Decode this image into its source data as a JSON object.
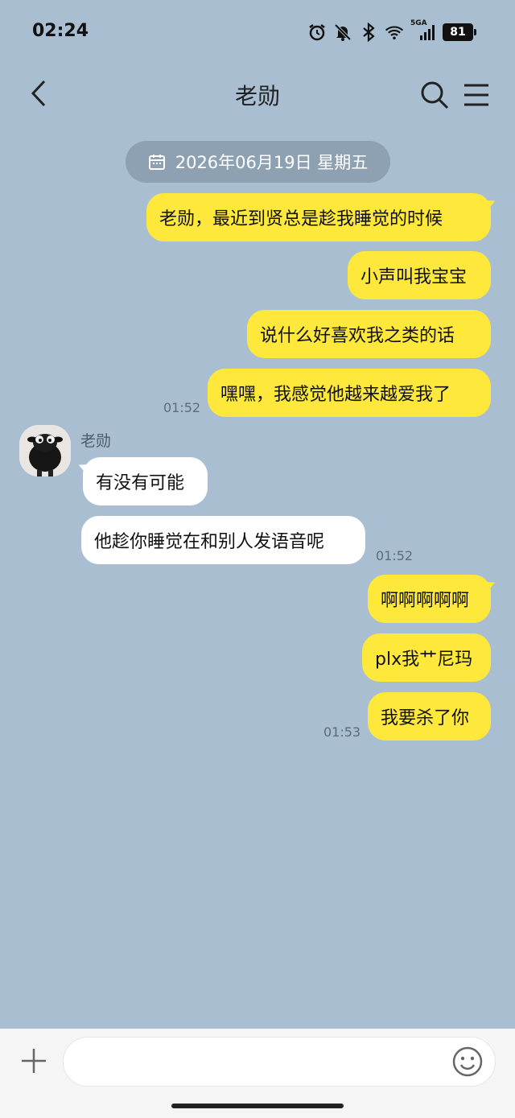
{
  "status_bar": {
    "time": "02:24",
    "network": "5GA",
    "battery": "81",
    "icons": [
      "alarm-icon",
      "mute-bell-icon",
      "bluetooth-icon",
      "wifi-icon",
      "signal-icon",
      "battery-icon"
    ]
  },
  "header": {
    "title": "老勋",
    "icons": [
      "back-arrow-icon",
      "search-icon",
      "menu-icon"
    ]
  },
  "date_divider": "2026年06月19日 星期五",
  "messages": [
    {
      "side": "me",
      "text": "老勋，最近到贤总是趁我睡觉的时候"
    },
    {
      "side": "me",
      "text": "小声叫我宝宝"
    },
    {
      "side": "me",
      "text": "说什么好喜欢我之类的话"
    },
    {
      "side": "me",
      "text": "嘿嘿，我感觉他越来越爱我了",
      "time": "01:52"
    },
    {
      "side": "other",
      "sender": "老勋",
      "text": "有没有可能"
    },
    {
      "side": "other",
      "text": "他趁你睡觉在和别人发语音呢",
      "time": "01:52"
    },
    {
      "side": "me",
      "text": "啊啊啊啊啊"
    },
    {
      "side": "me",
      "text": "plx我艹尼玛"
    },
    {
      "side": "me",
      "text": "我要杀了你",
      "time": "01:53"
    }
  ],
  "input": {
    "value": "",
    "placeholder": "",
    "icons": [
      "plus-icon",
      "emoji-icon"
    ]
  },
  "colors": {
    "background": "#a9bfd1",
    "my_bubble": "#fde83b",
    "other_bubble": "#ffffff",
    "date_pill": "#8ea1b3"
  }
}
